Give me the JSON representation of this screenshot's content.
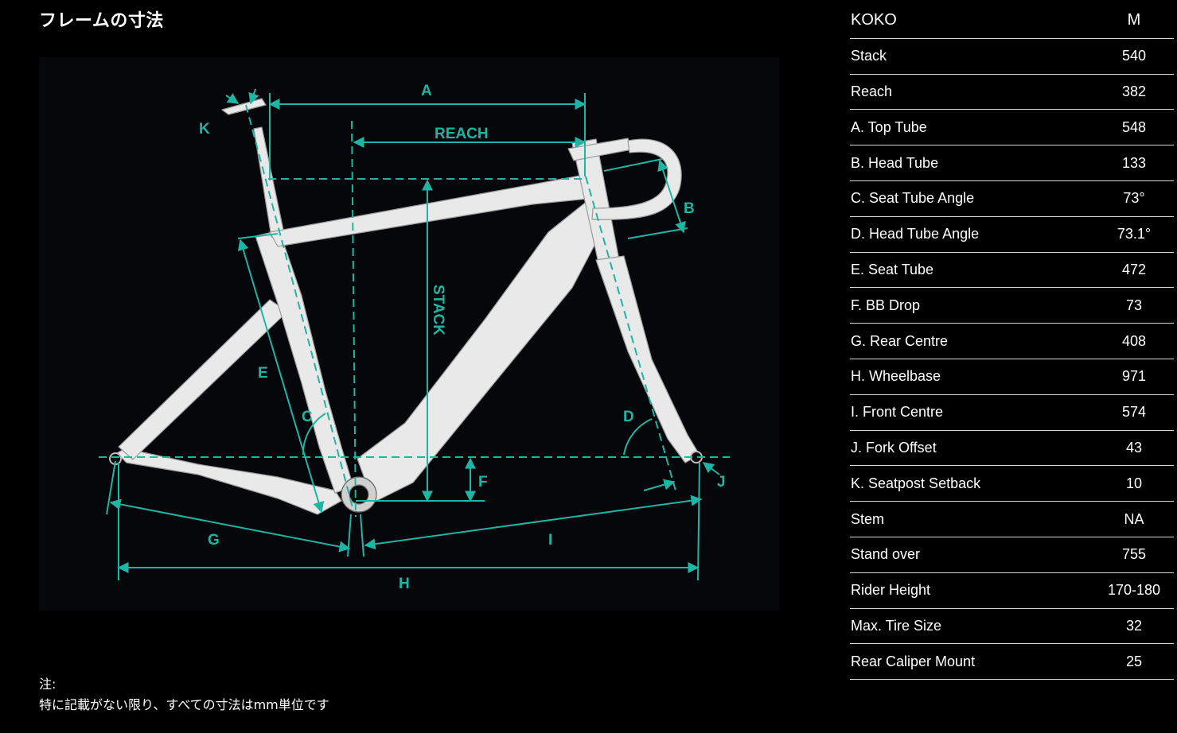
{
  "page": {
    "title": "フレームの寸法",
    "note_heading": "注:",
    "note_text": "特に記載がない限り、すべての寸法はmm単位です"
  },
  "colors": {
    "background": "#000000",
    "accent": "#1fb5a5",
    "frame": "#e9e9e9"
  },
  "diagram": {
    "labels": {
      "a": "A",
      "reach": "REACH",
      "stack": "STACK",
      "b": "B",
      "c": "C",
      "d": "D",
      "e": "E",
      "f": "F",
      "g": "G",
      "h": "H",
      "i": "I",
      "j": "J",
      "k": "K"
    }
  },
  "table": {
    "header": {
      "model": "KOKO",
      "size": "M"
    },
    "rows": [
      {
        "label": "Stack",
        "value": "540"
      },
      {
        "label": "Reach",
        "value": "382"
      },
      {
        "label": "A. Top Tube",
        "value": "548"
      },
      {
        "label": "B. Head Tube",
        "value": "133"
      },
      {
        "label": "C. Seat Tube Angle",
        "value": "73°"
      },
      {
        "label": "D. Head Tube Angle",
        "value": "73.1°"
      },
      {
        "label": "E. Seat Tube",
        "value": "472"
      },
      {
        "label": "F. BB Drop",
        "value": "73"
      },
      {
        "label": "G. Rear Centre",
        "value": "408"
      },
      {
        "label": "H. Wheelbase",
        "value": "971"
      },
      {
        "label": "I. Front Centre",
        "value": "574"
      },
      {
        "label": "J. Fork Offset",
        "value": "43"
      },
      {
        "label": "K. Seatpost Setback",
        "value": "10"
      },
      {
        "label": "Stem",
        "value": "NA"
      },
      {
        "label": "Stand over",
        "value": "755"
      },
      {
        "label": "Rider Height",
        "value": "170-180"
      },
      {
        "label": "Max. Tire Size",
        "value": "32"
      },
      {
        "label": "Rear Caliper Mount",
        "value": "25"
      }
    ]
  }
}
